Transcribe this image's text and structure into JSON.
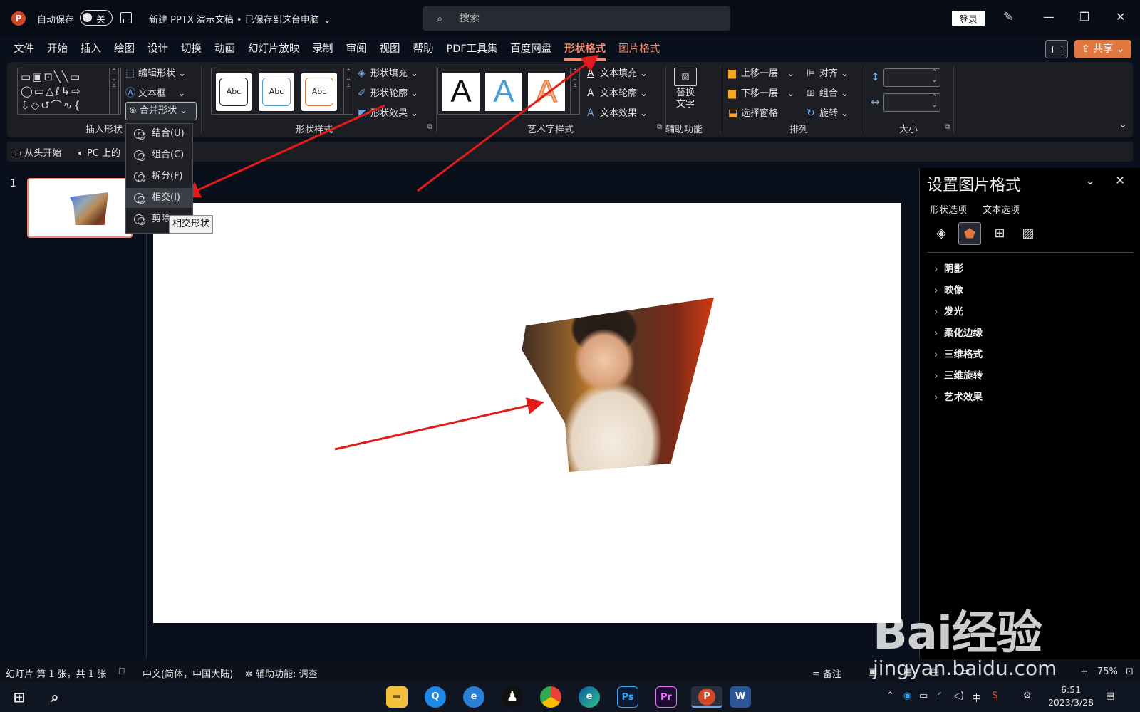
{
  "titlebar": {
    "app_logo": "P",
    "autosave_label": "自动保存",
    "autosave_state": "关",
    "doc_title": "新建 PPTX 演示文稿 • 已保存到这台电脑",
    "search_placeholder": "搜索",
    "login": "登录"
  },
  "tabs": [
    "文件",
    "开始",
    "插入",
    "绘图",
    "设计",
    "切换",
    "动画",
    "幻灯片放映",
    "录制",
    "审阅",
    "视图",
    "帮助",
    "PDF工具集",
    "百度网盘",
    "形状格式",
    "图片格式"
  ],
  "active_tab": "形状格式",
  "share": "共享",
  "ribbon": {
    "insert_shapes": {
      "label": "插入形状",
      "edit_shape": "编辑形状",
      "text_box": "文本框",
      "merge_shapes": "合并形状"
    },
    "shape_styles": {
      "label": "形状样式",
      "sample": "Abc",
      "fill": "形状填充",
      "outline": "形状轮廓",
      "effects": "形状效果"
    },
    "wordart_styles": {
      "label": "艺术字样式",
      "sample": "A",
      "text_fill": "文本填充",
      "text_outline": "文本轮廓",
      "text_effects": "文本效果"
    },
    "accessibility": {
      "label": "辅助功能",
      "alt_text_line1": "替换",
      "alt_text_line2": "文字"
    },
    "arrange": {
      "label": "排列",
      "bring_forward": "上移一层",
      "send_backward": "下移一层",
      "selection_pane": "选择窗格",
      "align": "对齐",
      "group": "组合",
      "rotate": "旋转"
    },
    "size": {
      "label": "大小"
    }
  },
  "qat": {
    "from_start": "从头开始",
    "pc_on": "PC 上的"
  },
  "merge_menu": {
    "items": [
      "结合(U)",
      "组合(C)",
      "拆分(F)",
      "相交(I)",
      "剪除"
    ],
    "highlighted": "相交(I)",
    "tooltip": "相交形状"
  },
  "thumbnails": {
    "slide_number": "1"
  },
  "format_pane": {
    "title": "设置图片格式",
    "tab_shape": "形状选项",
    "tab_text": "文本选项",
    "sections": [
      "阴影",
      "映像",
      "发光",
      "柔化边缘",
      "三维格式",
      "三维旋转",
      "艺术效果"
    ]
  },
  "statusbar": {
    "slide_info": "幻灯片 第 1 张，共 1 张",
    "language": "中文(简体，中国大陆)",
    "accessibility": "辅助功能: 调查",
    "notes": "备注",
    "zoom": "75%"
  },
  "taskbar": {
    "time": "6:51",
    "date": "2023/3/28",
    "ime": "中",
    "apps": [
      "Ps",
      "Pr",
      "P",
      "W"
    ]
  },
  "watermark": {
    "brand": "Bai经验",
    "url": "jingyan.baidu.com"
  },
  "colors": {
    "accent": "#f28c6b",
    "share": "#e0773f",
    "arrow": "#e21b1b"
  }
}
